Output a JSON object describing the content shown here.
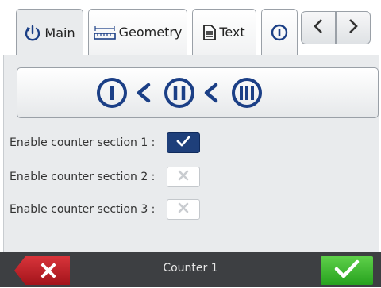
{
  "tabs": [
    {
      "label": "Main",
      "icon": "power-cycle-icon",
      "active": true
    },
    {
      "label": "Geometry",
      "icon": "ruler-icon",
      "active": false
    },
    {
      "label": "Text",
      "icon": "document-icon",
      "active": false
    },
    {
      "label": "",
      "icon": "counter-one-icon",
      "active": false
    }
  ],
  "nav": {
    "prev_icon": "chevron-left-icon",
    "next_icon": "chevron-right-icon"
  },
  "sequence": {
    "items": [
      "counter-section-1-icon",
      "counter-section-2-icon",
      "counter-section-3-icon"
    ],
    "color": "#1b3f86"
  },
  "rows": [
    {
      "label": "Enable counter section 1 :",
      "checked": true
    },
    {
      "label": "Enable counter section 2 :",
      "checked": false
    },
    {
      "label": "Enable counter section 3 :",
      "checked": false
    }
  ],
  "bottom": {
    "title": "Counter 1",
    "cancel_color": "#c0242b",
    "ok_color": "#3bb32d"
  }
}
